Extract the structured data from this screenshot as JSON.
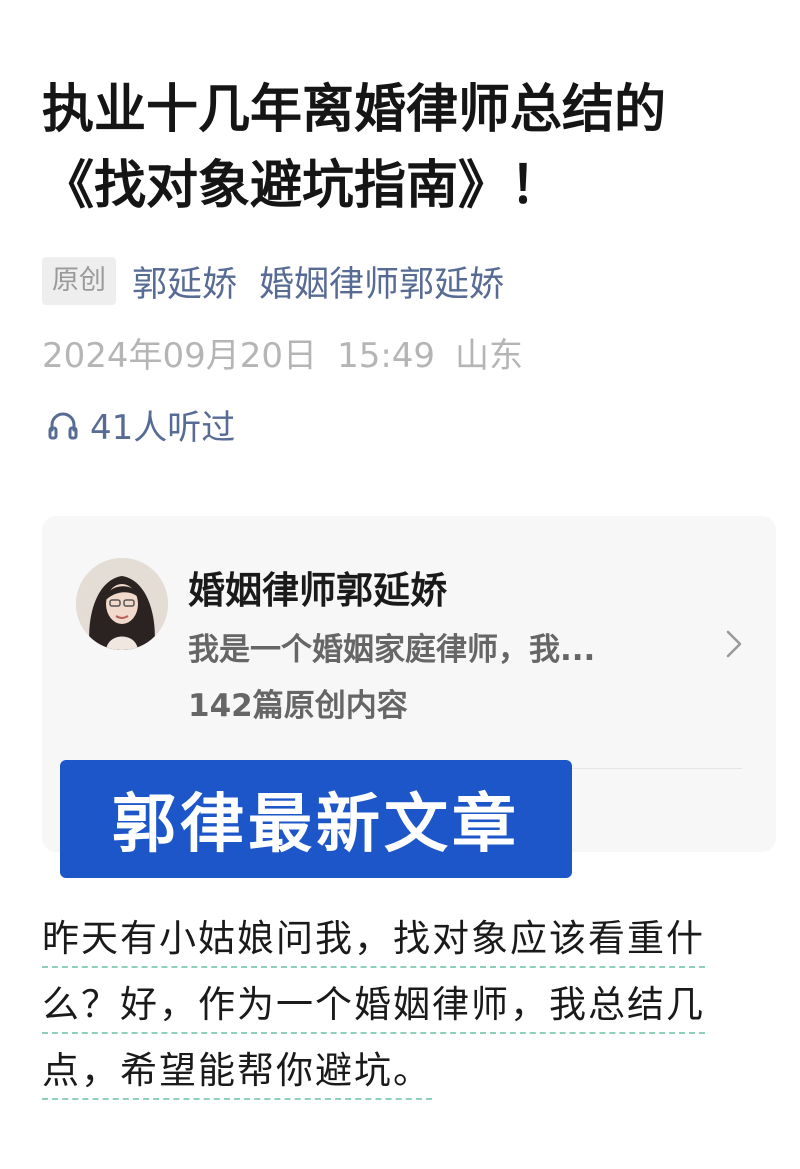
{
  "article": {
    "title_lines": [
      "执业十几年离婚律师总结的",
      "《找对象避坑指南》！"
    ],
    "original_tag": "原创",
    "author": "郭延娇",
    "account_link": "婚姻律师郭延娇",
    "date": "2024年09月20日",
    "time": "15:49",
    "location": "山东",
    "listen_count": "41人听过"
  },
  "account_card": {
    "name": "婚姻律师郭延娇",
    "description": "我是一个婚姻家庭律师，我...",
    "article_count": "142篇原创内容"
  },
  "banner": {
    "text": "郭律最新文章",
    "color": "#1d56c8"
  },
  "body": {
    "lines": [
      "昨天有小姑娘问我，找对象应该看重什",
      "么？好，作为一个婚姻律师，我总结几",
      "点，希望能帮你避坑。"
    ]
  },
  "colors": {
    "link": "#576b95",
    "meta_gray": "#b5b5b5",
    "underline": "#8fd1b8"
  },
  "icons": {
    "listen": "headphones-icon",
    "card_arrow": "chevron-right-icon"
  }
}
